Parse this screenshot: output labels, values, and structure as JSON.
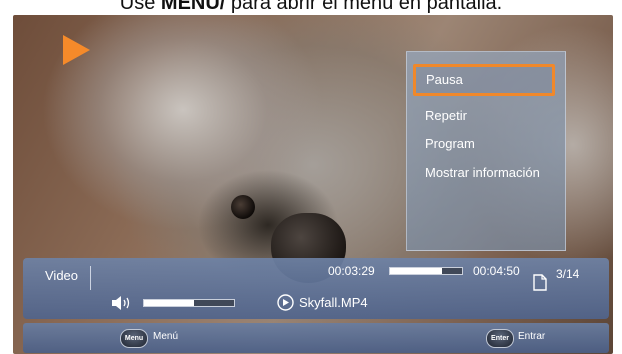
{
  "caption": {
    "prefix": "Use ",
    "bold": "MENU/",
    "suffix": " para abrir el menú en pantalla."
  },
  "menu": {
    "items": [
      "Pausa",
      "Repetir",
      "Program",
      "Mostrar información"
    ],
    "selected_index": 0
  },
  "info_bar": {
    "mode": "Video",
    "elapsed": "00:03:29",
    "total": "00:04:50",
    "progress_fraction": 0.72,
    "file_index": "3/14",
    "volume_fraction": 0.55,
    "filename": "Skyfall.MP4"
  },
  "bottom_bar": {
    "menu_key": "Menu",
    "menu_label": "Menú",
    "enter_key": "Enter",
    "enter_label": "Entrar"
  },
  "colors": {
    "accent": "#f0882a",
    "play_icon": "#f58a2a"
  }
}
